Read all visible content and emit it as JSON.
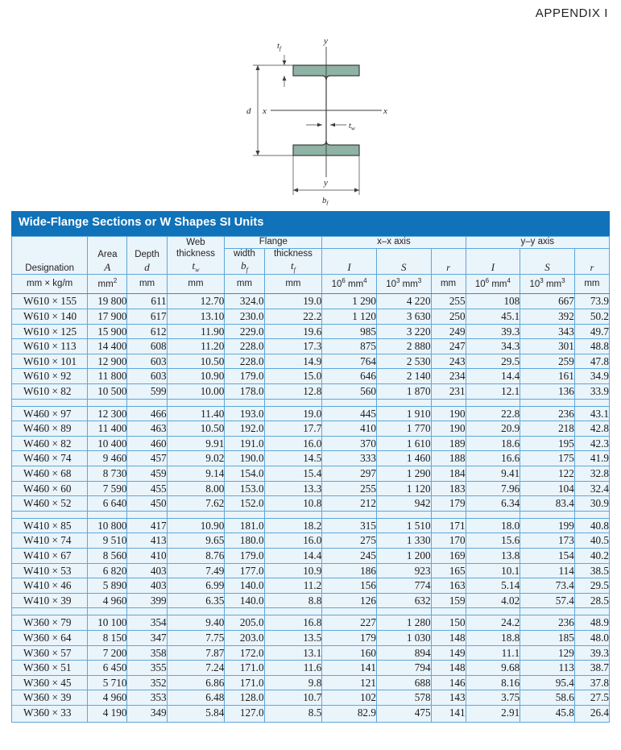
{
  "appendix": {
    "label": "APPENDIX I"
  },
  "figure": {
    "name": "wide-flange-cross-section",
    "beam_fill": "#8fb3a4",
    "beam_stroke": "#3e3e3e",
    "labels": {
      "flange_thickness": "t_f",
      "web_thickness": "t_w",
      "depth": "d",
      "flange_width": "b_f",
      "axis_y_top": "y",
      "axis_y_bottom": "y",
      "axis_x_left": "x",
      "axis_x_right": "x"
    }
  },
  "table": {
    "title": "Wide-Flange Sections or W Shapes SI Units",
    "group_headers": {
      "flange": "Flange",
      "x_axis": "x–x axis",
      "y_axis": "y–y axis"
    },
    "column_headers": [
      {
        "title": "Designation",
        "symbol": "",
        "unit": "mm × kg/m"
      },
      {
        "title": "Area",
        "symbol": "A",
        "unit": "mm2"
      },
      {
        "title": "Depth",
        "symbol": "d",
        "unit": "mm"
      },
      {
        "title": "Web thickness",
        "symbol": "tw",
        "unit": "mm"
      },
      {
        "title": "width",
        "symbol": "bf",
        "unit": "mm"
      },
      {
        "title": "thickness",
        "symbol": "tf",
        "unit": "mm"
      },
      {
        "title": "",
        "symbol": "I",
        "unit": "106 mm4"
      },
      {
        "title": "",
        "symbol": "S",
        "unit": "103 mm3"
      },
      {
        "title": "",
        "symbol": "r",
        "unit": "mm"
      },
      {
        "title": "",
        "symbol": "I",
        "unit": "106 mm4"
      },
      {
        "title": "",
        "symbol": "S",
        "unit": "103 mm3"
      },
      {
        "title": "",
        "symbol": "r",
        "unit": "mm"
      }
    ],
    "groups": [
      {
        "name": "W610",
        "rows": [
          [
            "W610 × 155",
            "19 800",
            "611",
            "12.70",
            "324.0",
            "19.0",
            "1 290",
            "4 220",
            "255",
            "108",
            "667",
            "73.9"
          ],
          [
            "W610 × 140",
            "17 900",
            "617",
            "13.10",
            "230.0",
            "22.2",
            "1 120",
            "3 630",
            "250",
            "45.1",
            "392",
            "50.2"
          ],
          [
            "W610 × 125",
            "15 900",
            "612",
            "11.90",
            "229.0",
            "19.6",
            "985",
            "3 220",
            "249",
            "39.3",
            "343",
            "49.7"
          ],
          [
            "W610 × 113",
            "14 400",
            "608",
            "11.20",
            "228.0",
            "17.3",
            "875",
            "2 880",
            "247",
            "34.3",
            "301",
            "48.8"
          ],
          [
            "W610 × 101",
            "12 900",
            "603",
            "10.50",
            "228.0",
            "14.9",
            "764",
            "2 530",
            "243",
            "29.5",
            "259",
            "47.8"
          ],
          [
            "W610 × 92",
            "11 800",
            "603",
            "10.90",
            "179.0",
            "15.0",
            "646",
            "2 140",
            "234",
            "14.4",
            "161",
            "34.9"
          ],
          [
            "W610 × 82",
            "10 500",
            "599",
            "10.00",
            "178.0",
            "12.8",
            "560",
            "1 870",
            "231",
            "12.1",
            "136",
            "33.9"
          ]
        ]
      },
      {
        "name": "W460",
        "rows": [
          [
            "W460 × 97",
            "12 300",
            "466",
            "11.40",
            "193.0",
            "19.0",
            "445",
            "1 910",
            "190",
            "22.8",
            "236",
            "43.1"
          ],
          [
            "W460 × 89",
            "11 400",
            "463",
            "10.50",
            "192.0",
            "17.7",
            "410",
            "1 770",
            "190",
            "20.9",
            "218",
            "42.8"
          ],
          [
            "W460 × 82",
            "10 400",
            "460",
            "9.91",
            "191.0",
            "16.0",
            "370",
            "1 610",
            "189",
            "18.6",
            "195",
            "42.3"
          ],
          [
            "W460 × 74",
            "9 460",
            "457",
            "9.02",
            "190.0",
            "14.5",
            "333",
            "1 460",
            "188",
            "16.6",
            "175",
            "41.9"
          ],
          [
            "W460 × 68",
            "8 730",
            "459",
            "9.14",
            "154.0",
            "15.4",
            "297",
            "1 290",
            "184",
            "9.41",
            "122",
            "32.8"
          ],
          [
            "W460 × 60",
            "7 590",
            "455",
            "8.00",
            "153.0",
            "13.3",
            "255",
            "1 120",
            "183",
            "7.96",
            "104",
            "32.4"
          ],
          [
            "W460 × 52",
            "6 640",
            "450",
            "7.62",
            "152.0",
            "10.8",
            "212",
            "942",
            "179",
            "6.34",
            "83.4",
            "30.9"
          ]
        ]
      },
      {
        "name": "W410",
        "rows": [
          [
            "W410 × 85",
            "10 800",
            "417",
            "10.90",
            "181.0",
            "18.2",
            "315",
            "1 510",
            "171",
            "18.0",
            "199",
            "40.8"
          ],
          [
            "W410 × 74",
            "9 510",
            "413",
            "9.65",
            "180.0",
            "16.0",
            "275",
            "1 330",
            "170",
            "15.6",
            "173",
            "40.5"
          ],
          [
            "W410 × 67",
            "8 560",
            "410",
            "8.76",
            "179.0",
            "14.4",
            "245",
            "1 200",
            "169",
            "13.8",
            "154",
            "40.2"
          ],
          [
            "W410 × 53",
            "6 820",
            "403",
            "7.49",
            "177.0",
            "10.9",
            "186",
            "923",
            "165",
            "10.1",
            "114",
            "38.5"
          ],
          [
            "W410 × 46",
            "5 890",
            "403",
            "6.99",
            "140.0",
            "11.2",
            "156",
            "774",
            "163",
            "5.14",
            "73.4",
            "29.5"
          ],
          [
            "W410 × 39",
            "4 960",
            "399",
            "6.35",
            "140.0",
            "8.8",
            "126",
            "632",
            "159",
            "4.02",
            "57.4",
            "28.5"
          ]
        ]
      },
      {
        "name": "W360",
        "rows": [
          [
            "W360 × 79",
            "10 100",
            "354",
            "9.40",
            "205.0",
            "16.8",
            "227",
            "1 280",
            "150",
            "24.2",
            "236",
            "48.9"
          ],
          [
            "W360 × 64",
            "8 150",
            "347",
            "7.75",
            "203.0",
            "13.5",
            "179",
            "1 030",
            "148",
            "18.8",
            "185",
            "48.0"
          ],
          [
            "W360 × 57",
            "7 200",
            "358",
            "7.87",
            "172.0",
            "13.1",
            "160",
            "894",
            "149",
            "11.1",
            "129",
            "39.3"
          ],
          [
            "W360 × 51",
            "6 450",
            "355",
            "7.24",
            "171.0",
            "11.6",
            "141",
            "794",
            "148",
            "9.68",
            "113",
            "38.7"
          ],
          [
            "W360 × 45",
            "5 710",
            "352",
            "6.86",
            "171.0",
            "9.8",
            "121",
            "688",
            "146",
            "8.16",
            "95.4",
            "37.8"
          ],
          [
            "W360 × 39",
            "4 960",
            "353",
            "6.48",
            "128.0",
            "10.7",
            "102",
            "578",
            "143",
            "3.75",
            "58.6",
            "27.5"
          ],
          [
            "W360 × 33",
            "4 190",
            "349",
            "5.84",
            "127.0",
            "8.5",
            "82.9",
            "475",
            "141",
            "2.91",
            "45.8",
            "26.4"
          ]
        ]
      }
    ]
  },
  "colors": {
    "title_bar": "#1072b9",
    "cell_bg": "#eaf4fb",
    "grid": "#5ea7d8",
    "frame": "#3f86bd",
    "beam": "#8fb3a4"
  }
}
